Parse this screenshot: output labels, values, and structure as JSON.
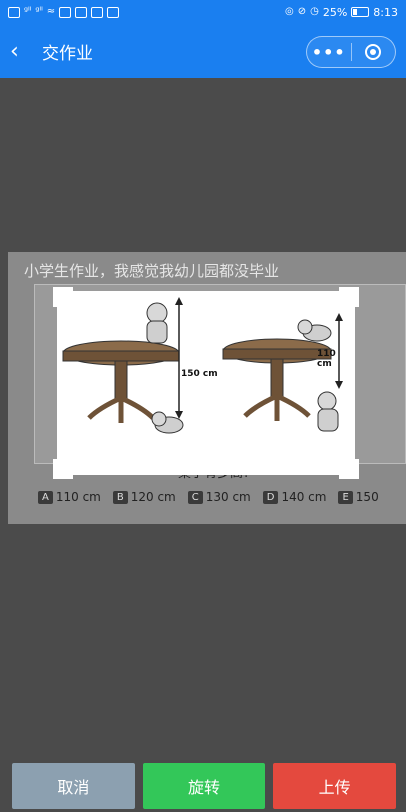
{
  "status_bar": {
    "left_signal_1": "ᵍˡˡ",
    "left_signal_2": "ᵍˡˡ",
    "battery_percent": "25%",
    "time": "8:13"
  },
  "nav": {
    "title": "交作业",
    "more_label": "•••"
  },
  "image": {
    "caption": "小学生作业，我感觉我幼儿园都没毕业",
    "question": "桌子有多高?",
    "label_left": "150 cm",
    "label_right": "110 cm",
    "options": [
      {
        "letter": "A",
        "text": "110 cm"
      },
      {
        "letter": "B",
        "text": "120 cm"
      },
      {
        "letter": "C",
        "text": "130 cm"
      },
      {
        "letter": "D",
        "text": "140 cm"
      },
      {
        "letter": "E",
        "text": "150"
      }
    ]
  },
  "actions": {
    "cancel": "取消",
    "rotate": "旋转",
    "upload": "上传"
  },
  "colors": {
    "nav_bg": "#1a7ff0",
    "cancel": "#8ca0b0",
    "rotate": "#33c759",
    "upload": "#e4493e"
  },
  "icons": {
    "back": "chevron-left-icon",
    "more": "more-dots-icon",
    "target": "target-icon"
  }
}
